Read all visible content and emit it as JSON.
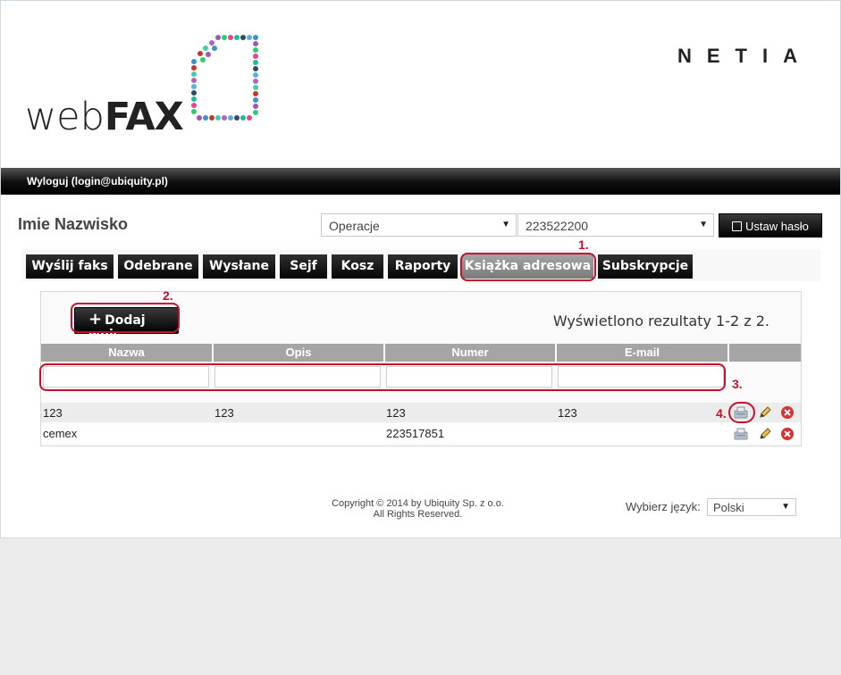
{
  "brand": {
    "name_light": "web",
    "name_bold": "FAX",
    "company": "NETIA"
  },
  "topbar": {
    "logout": "Wyloguj (login@ubiquity.pl)"
  },
  "user": {
    "name": "Imie Nazwisko"
  },
  "controls": {
    "operations_select": "Operacje",
    "number_select": "223522200",
    "set_password": "Ustaw hasło"
  },
  "tabs": [
    {
      "label": "Wyślij faks"
    },
    {
      "label": "Odebrane"
    },
    {
      "label": "Wysłane"
    },
    {
      "label": "Sejf"
    },
    {
      "label": "Kosz"
    },
    {
      "label": "Raporty"
    },
    {
      "label": "Książka adresowa",
      "active": true
    },
    {
      "label": "Subskrypcje"
    }
  ],
  "panel": {
    "add_button": "Dodaj wpis",
    "results": "Wyświetlono rezultaty 1-2 z 2.",
    "columns": [
      "Nazwa",
      "Opis",
      "Numer",
      "E-mail"
    ],
    "rows": [
      {
        "name": "123",
        "desc": "123",
        "number": "123",
        "email": "123"
      },
      {
        "name": "cemex",
        "desc": "",
        "number": "223517851",
        "email": ""
      }
    ]
  },
  "annotations": {
    "n1": "1.",
    "n2": "2.",
    "n3": "3.",
    "n4": "4."
  },
  "footer": {
    "copyright": "Copyright © 2014 by Ubiquity Sp. z o.o.",
    "rights": "All Rights Reserved.",
    "language_label": "Wybierz język:",
    "language_value": "Polski"
  },
  "colors": {
    "accent_red": "#c8102e",
    "topbar": "#000000",
    "header_gray": "#a5a5a5"
  }
}
